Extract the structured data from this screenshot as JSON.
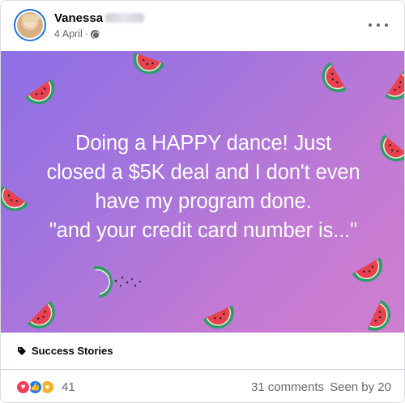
{
  "post": {
    "author_name": "Vanessa",
    "date": "4 April",
    "separator": "·",
    "privacy_icon": "globe-icon",
    "more_icon": "more-options-icon"
  },
  "image": {
    "text_lines": [
      "Doing a HAPPY dance! Just",
      "closed a $5K deal and I don't even",
      "have my program done.",
      "\"and your credit card number is...\""
    ],
    "decoration": "watermelon-slice-icons",
    "gradient_colors": [
      "#8e6fe6",
      "#c27ad4",
      "#cf7fcf"
    ]
  },
  "tag": {
    "icon": "tag-icon",
    "label": "Success Stories"
  },
  "footer": {
    "reactions": [
      "love",
      "like",
      "wow"
    ],
    "reaction_count": "41",
    "comments": "31 comments",
    "seen_by": "Seen by 20"
  },
  "colors": {
    "text_primary": "#050505",
    "text_secondary": "#65676b",
    "like_blue": "#1877f2",
    "love_red": "#f33e58",
    "wow_yellow": "#f7b125"
  }
}
